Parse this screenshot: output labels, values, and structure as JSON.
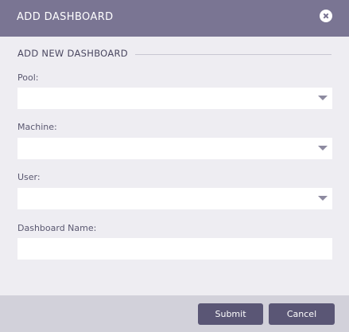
{
  "dialog": {
    "title": "ADD DASHBOARD"
  },
  "form": {
    "section_title": "ADD NEW DASHBOARD",
    "fields": [
      {
        "label": "Pool:",
        "type": "select",
        "value": ""
      },
      {
        "label": "Machine:",
        "type": "select",
        "value": ""
      },
      {
        "label": "User:",
        "type": "select",
        "value": ""
      },
      {
        "label": "Dashboard Name:",
        "type": "text",
        "value": ""
      }
    ]
  },
  "footer": {
    "submit_label": "Submit",
    "cancel_label": "Cancel"
  },
  "colors": {
    "header_bg": "#7a7593",
    "body_bg": "#eeedf2",
    "footer_bg": "#d2d1da",
    "button_bg": "#5a5675"
  },
  "icons": {
    "close": "close-icon",
    "dropdown": "chevron-down-icon"
  }
}
